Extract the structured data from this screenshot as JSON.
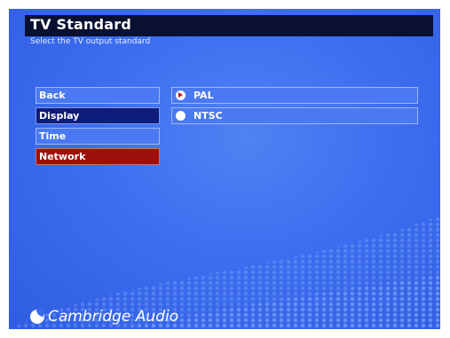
{
  "header": {
    "title": "TV Standard",
    "subtitle": "Select the TV output standard"
  },
  "menu": {
    "items": [
      {
        "label": "Back",
        "state": "normal"
      },
      {
        "label": "Display",
        "state": "selected"
      },
      {
        "label": "Time",
        "state": "normal"
      },
      {
        "label": "Network",
        "state": "highlighted"
      }
    ]
  },
  "options": {
    "items": [
      {
        "label": "PAL",
        "checked": true
      },
      {
        "label": "NTSC",
        "checked": false
      }
    ]
  },
  "brand": {
    "name": "Cambridge Audio"
  },
  "colors": {
    "background": "#3d6ef0",
    "header": "#0a1030",
    "selected": "#101c7a",
    "highlight": "#9c0f0b",
    "radio_mark": "#c0162a"
  }
}
